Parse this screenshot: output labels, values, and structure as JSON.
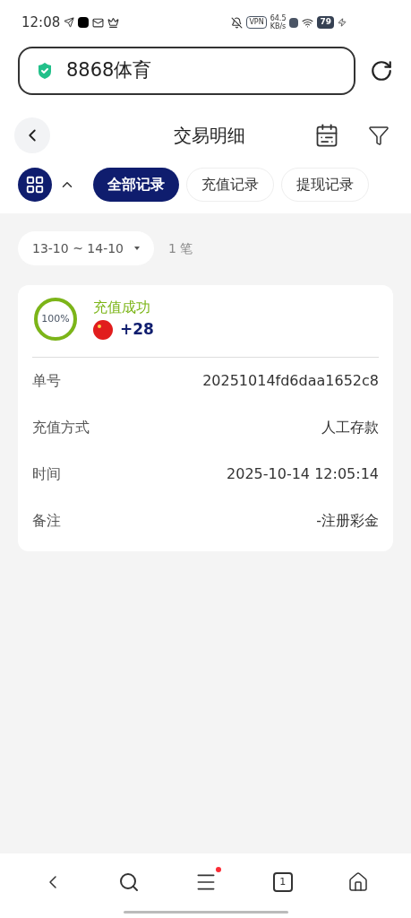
{
  "status_bar": {
    "time": "12:08",
    "vpn": "VPN",
    "speed_value": "64.5",
    "speed_unit": "KB/s",
    "battery": "79"
  },
  "address_bar": {
    "value": "8868体育"
  },
  "header": {
    "title": "交易明细"
  },
  "tabs": [
    {
      "label": "全部记录",
      "selected": true
    },
    {
      "label": "充值记录",
      "selected": false
    },
    {
      "label": "提现记录",
      "selected": false
    }
  ],
  "filter": {
    "date_range": "13-10 ~ 14-10",
    "count": "1 笔"
  },
  "records": [
    {
      "progress_label": "100%",
      "status": "充值成功",
      "amount": "+28",
      "details": [
        {
          "label": "单号",
          "value": "20251014fd6daa1652c8"
        },
        {
          "label": "充值方式",
          "value": "人工存款"
        },
        {
          "label": "时间",
          "value": "2025-10-14 12:05:14"
        },
        {
          "label": "备注",
          "value": "-注册彩金"
        }
      ]
    }
  ],
  "bottom_nav": {
    "tab_count": "1",
    "menu_badge": true
  }
}
